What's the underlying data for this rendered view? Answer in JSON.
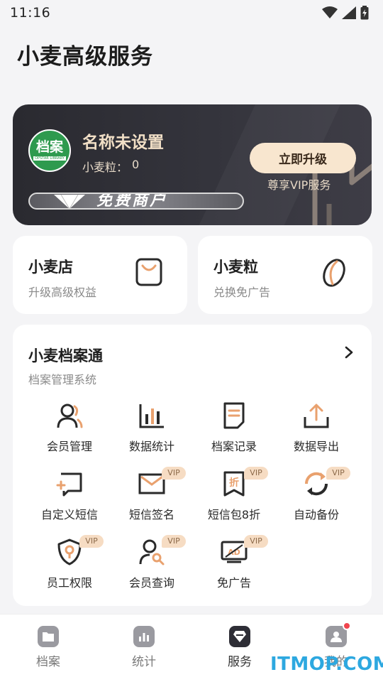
{
  "status_bar": {
    "time": "11:16"
  },
  "page": {
    "title": "小麦高级服务"
  },
  "vip_card": {
    "avatar_text": "档案",
    "avatar_subtext": "OPSTAR LIBRARY",
    "user_name": "名称未设置",
    "grains_label": "小麦粒：",
    "grains_value": "0",
    "upgrade_button": "立即升级",
    "upgrade_subtext": "尊享VIP服务",
    "member_badge": "免费商户"
  },
  "shop_card": {
    "title": "小麦店",
    "subtitle": "升级高级权益"
  },
  "grains_card": {
    "title": "小麦粒",
    "subtitle": "兑换免广告"
  },
  "archive_panel": {
    "title": "小麦档案通",
    "subtitle": "档案管理系统",
    "vip_tag": "VIP",
    "items": [
      {
        "label": "会员管理",
        "icon": "user-icon",
        "vip": false
      },
      {
        "label": "数据统计",
        "icon": "chart-icon",
        "vip": false
      },
      {
        "label": "档案记录",
        "icon": "document-icon",
        "vip": false
      },
      {
        "label": "数据导出",
        "icon": "export-icon",
        "vip": false
      },
      {
        "label": "自定义短信",
        "icon": "add-message-icon",
        "vip": false
      },
      {
        "label": "短信签名",
        "icon": "envelope-icon",
        "vip": true
      },
      {
        "label": "短信包8折",
        "icon": "discount-icon",
        "vip": true
      },
      {
        "label": "自动备份",
        "icon": "sync-icon",
        "vip": true
      },
      {
        "label": "员工权限",
        "icon": "shield-icon",
        "vip": true
      },
      {
        "label": "会员查询",
        "icon": "user-search-icon",
        "vip": true
      },
      {
        "label": "免广告",
        "icon": "no-ads-icon",
        "vip": true
      }
    ]
  },
  "bottom_nav": {
    "items": [
      {
        "label": "档案",
        "icon": "folder-icon"
      },
      {
        "label": "统计",
        "icon": "stats-icon"
      },
      {
        "label": "服务",
        "icon": "diamond-icon",
        "active": true
      },
      {
        "label": "我的",
        "icon": "profile-icon",
        "has_notification": true
      }
    ]
  },
  "watermark": "ITMOP.COM",
  "colors": {
    "card_dark": "#2a2a30",
    "gold_text": "#f1dfc6",
    "upgrade_bg": "#f8e6cf",
    "vip_tag_bg": "#f6dcc3",
    "accent_orange": "#e9a16e",
    "notification": "#f0454e",
    "watermark": "#2da8e0"
  }
}
